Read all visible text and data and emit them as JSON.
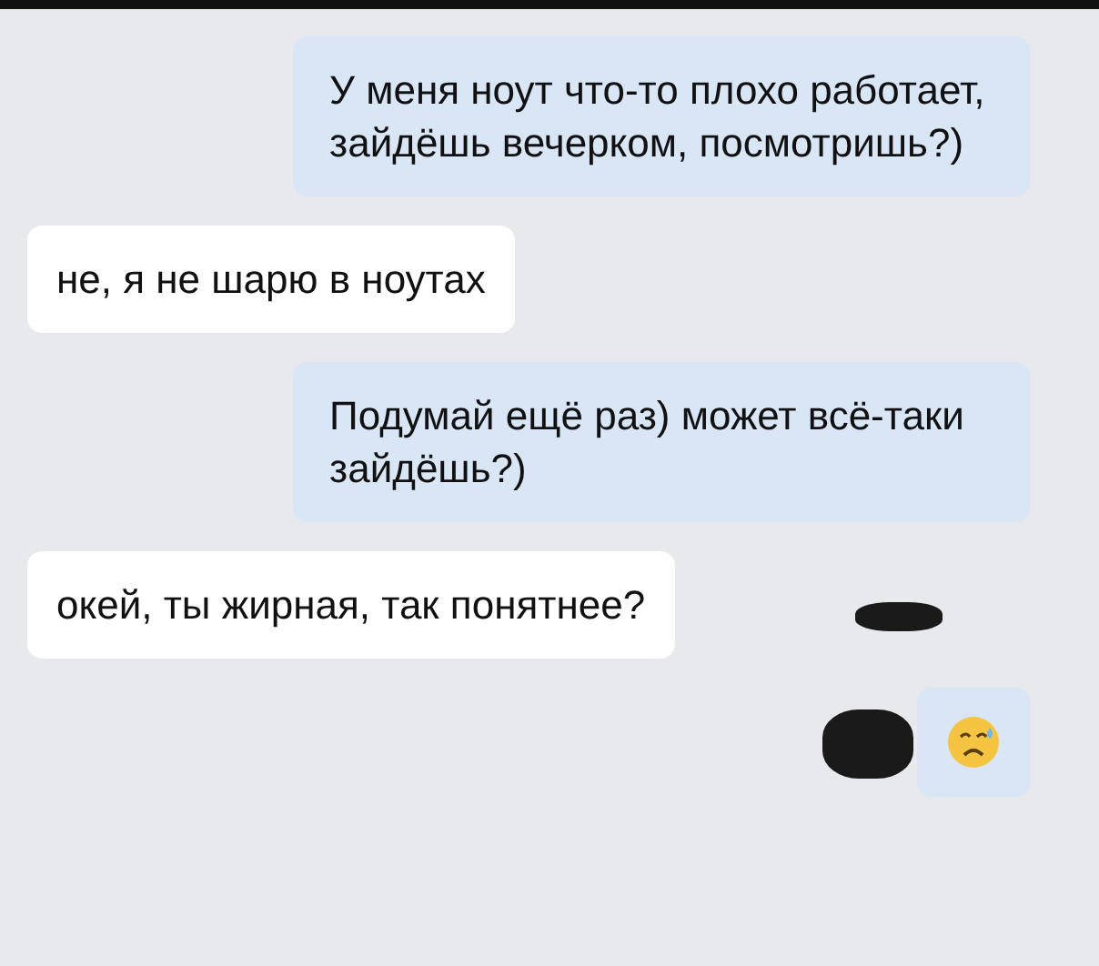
{
  "messages": [
    {
      "kind": "outgoing",
      "text": "У меня ноут что-то плохо работает, зайдёшь вечерком, посмотришь?)"
    },
    {
      "kind": "incoming",
      "text": "не, я не шарю в ноутах"
    },
    {
      "kind": "outgoing",
      "text": "Подумай ещё раз) может всё-таки зайдёшь?)"
    },
    {
      "kind": "incoming",
      "text": "окей, ты жирная, так понятнее?"
    },
    {
      "kind": "emoji"
    }
  ]
}
